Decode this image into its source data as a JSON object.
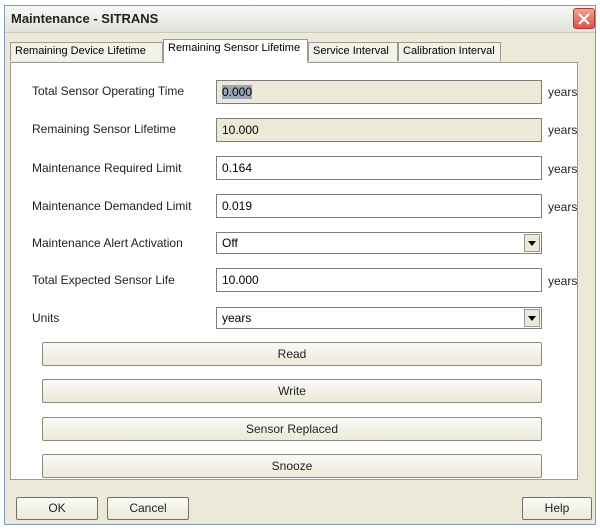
{
  "window": {
    "title": "Maintenance - SITRANS"
  },
  "tabs": [
    {
      "label": "Remaining Device Lifetime",
      "active": false
    },
    {
      "label": "Remaining Sensor Lifetime",
      "active": true
    },
    {
      "label": "Service Interval",
      "active": false
    },
    {
      "label": "Calibration Interval",
      "active": false
    }
  ],
  "fields": {
    "total_operating_time": {
      "label": "Total Sensor Operating Time",
      "value": "0.000",
      "unit": "years"
    },
    "remaining_lifetime": {
      "label": "Remaining Sensor Lifetime",
      "value": "10.000",
      "unit": "years"
    },
    "required_limit": {
      "label": "Maintenance Required Limit",
      "value": "0.164",
      "unit": "years"
    },
    "demanded_limit": {
      "label": "Maintenance Demanded Limit",
      "value": "0.019",
      "unit": "years"
    },
    "alert_activation": {
      "label": "Maintenance Alert Activation",
      "value": "Off"
    },
    "expected_life": {
      "label": "Total Expected Sensor Life",
      "value": "10.000",
      "unit": "years"
    },
    "units": {
      "label": "Units",
      "value": "years"
    }
  },
  "actions": {
    "read": "Read",
    "write": "Write",
    "sensor_replaced": "Sensor Replaced",
    "snooze": "Snooze"
  },
  "footer": {
    "ok": "OK",
    "cancel": "Cancel",
    "help": "Help"
  },
  "icons": {
    "close": "close-icon",
    "dropdown": "chevron-down-icon"
  },
  "colors": {
    "dialog_bg": "#ece9d8",
    "close_red": "#d9534f",
    "selection": "#9aa6b4"
  }
}
